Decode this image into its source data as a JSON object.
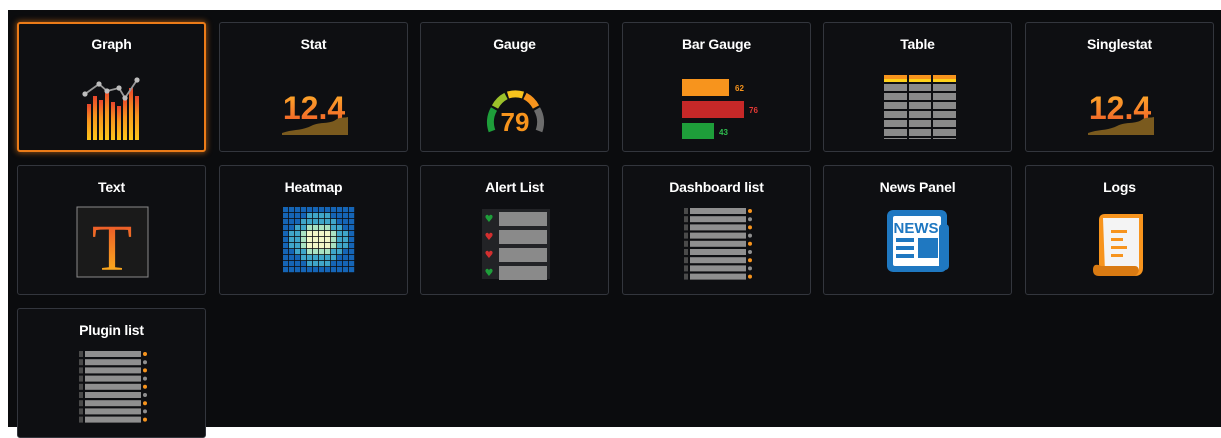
{
  "panels": [
    {
      "label": "Graph",
      "icon": "graph-icon",
      "selected": true
    },
    {
      "label": "Stat",
      "icon": "stat-icon",
      "value_text": "12.4"
    },
    {
      "label": "Gauge",
      "icon": "gauge-icon",
      "value_text": "79"
    },
    {
      "label": "Bar Gauge",
      "icon": "bar-gauge-icon",
      "bars": [
        "62",
        "76",
        "43"
      ]
    },
    {
      "label": "Table",
      "icon": "table-icon"
    },
    {
      "label": "Singlestat",
      "icon": "singlestat-icon",
      "value_text": "12.4"
    },
    {
      "label": "Text",
      "icon": "text-icon",
      "glyph": "T"
    },
    {
      "label": "Heatmap",
      "icon": "heatmap-icon"
    },
    {
      "label": "Alert List",
      "icon": "alert-list-icon"
    },
    {
      "label": "Dashboard list",
      "icon": "dashboard-list-icon"
    },
    {
      "label": "News Panel",
      "icon": "news-icon",
      "glyph": "NEWS"
    },
    {
      "label": "Logs",
      "icon": "logs-icon"
    },
    {
      "label": "Plugin list",
      "icon": "plugin-list-icon"
    }
  ],
  "colors": {
    "background": "#0b0c0e",
    "card": "#0e0f12",
    "card_border": "#33363d",
    "selected_border": "#eb7b18",
    "orange": "#f7941d",
    "red": "#d32f2f",
    "green": "#1e9e3a",
    "news_blue": "#1f78c1"
  }
}
